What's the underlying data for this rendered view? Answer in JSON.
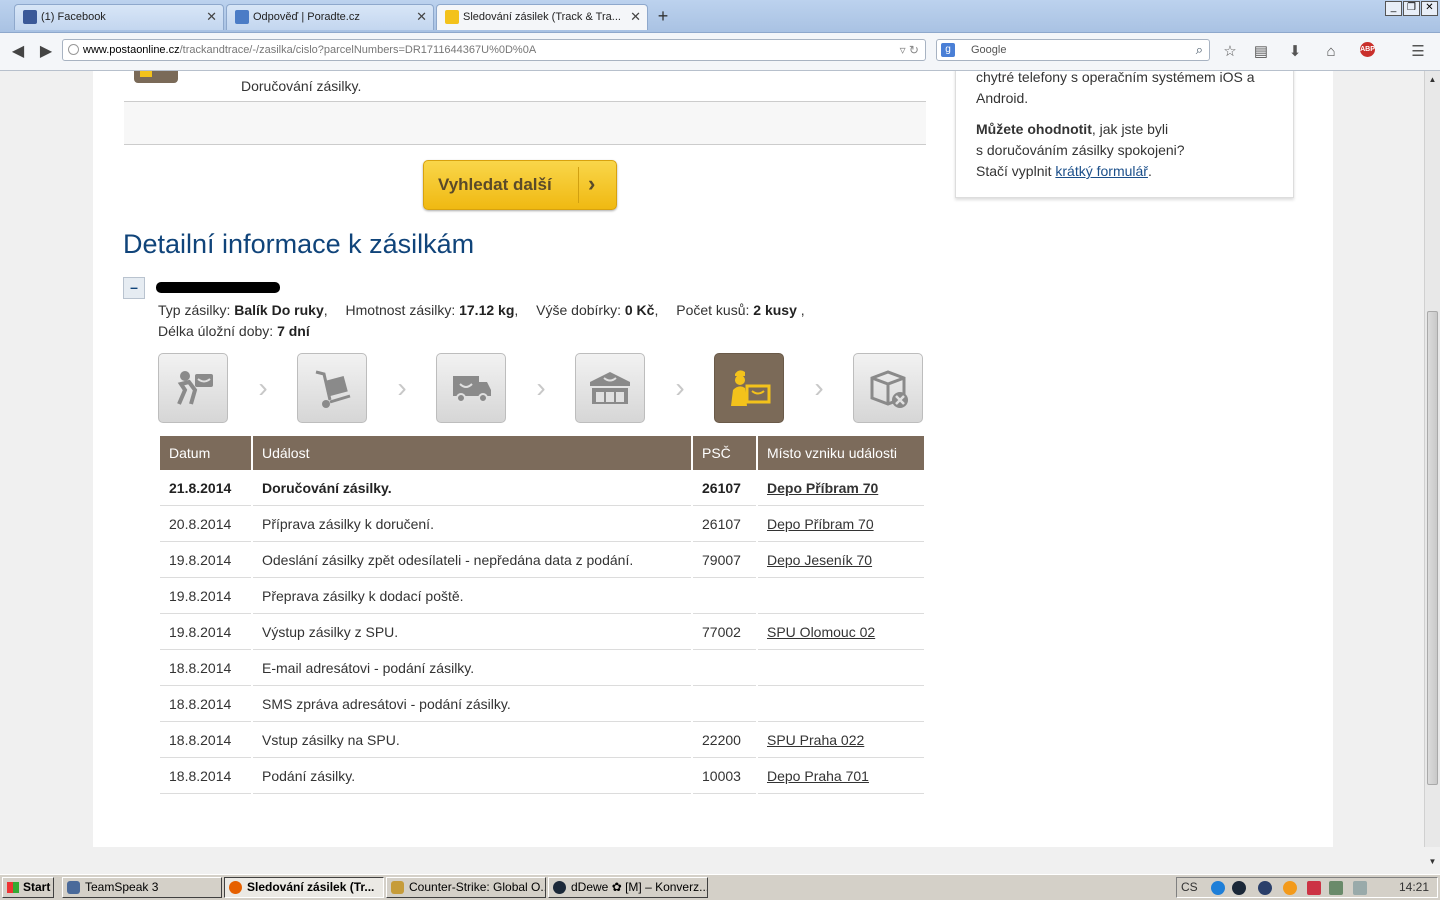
{
  "browser": {
    "tabs": [
      {
        "title": "(1) Facebook",
        "color": "#3b5998"
      },
      {
        "title": "Odpověď | Poradte.cz",
        "color": "#4b7cc6"
      },
      {
        "title": "Sledování zásilek (Track & Tra...",
        "color": "#f3c21b"
      }
    ],
    "url_domain": "www.postaonline.cz",
    "url_path": "/trackandtrace/-/zasilka/cislo?parcelNumbers=DR1711644367U%0D%0A",
    "search_placeholder": "Google"
  },
  "prev_item": {
    "event": "Doručování zásilky."
  },
  "sidebar": {
    "text1": "chytré telefony s operačním systémem iOS a Android.",
    "rate_bold": "Můžete ohodnotit",
    "rate_rest1": ", jak jste byli",
    "rate_rest2": "s doručováním zásilky spokojeni?",
    "form_prefix": "Stačí vyplnit ",
    "form_link": "krátký formulář",
    "form_suffix": "."
  },
  "search_next_label": "Vyhledat další",
  "detail_heading": "Detailní informace k zásilkám",
  "parcel": {
    "type_label": "Typ zásilky:",
    "type_value": "Balík Do ruky",
    "weight_label": "Hmotnost zásilky:",
    "weight_value": "17.12  kg",
    "cod_label": "Výše dobírky:",
    "cod_value": "0  Kč",
    "pieces_label": "Počet kusů:",
    "pieces_value": "2  kusy",
    "storage_label": "Délka úložní doby:",
    "storage_value": "7 dní"
  },
  "progress": {
    "active_step": 4,
    "steps": [
      "posted-icon",
      "warehouse-cart-icon",
      "delivery-truck-icon",
      "post-office-icon",
      "courier-delivering-icon",
      "undeliverable-box-icon"
    ]
  },
  "table": {
    "headers": [
      "Datum",
      "Událost",
      "PSČ",
      "Místo vzniku události"
    ],
    "rows": [
      [
        "21.8.2014",
        "Doručování zásilky.",
        "26107",
        "Depo Příbram 70"
      ],
      [
        "20.8.2014",
        "Příprava zásilky k doručení.",
        "26107",
        "Depo Příbram 70"
      ],
      [
        "19.8.2014",
        "Odeslání zásilky zpět odesílateli - nepředána data z podání.",
        "79007",
        "Depo Jeseník 70"
      ],
      [
        "19.8.2014",
        "Přeprava zásilky k dodací poště.",
        "",
        ""
      ],
      [
        "19.8.2014",
        "Výstup zásilky z SPU.",
        "77002",
        "SPU Olomouc 02"
      ],
      [
        "18.8.2014",
        "E-mail adresátovi - podání zásilky.",
        "",
        ""
      ],
      [
        "18.8.2014",
        "SMS zpráva adresátovi - podání zásilky.",
        "",
        ""
      ],
      [
        "18.8.2014",
        "Vstup zásilky na SPU.",
        "22200",
        "SPU Praha 022"
      ],
      [
        "18.8.2014",
        "Podání zásilky.",
        "10003",
        "Depo Praha 701"
      ]
    ]
  },
  "taskbar": {
    "start": "Start",
    "tasks": [
      {
        "label": "TeamSpeak 3",
        "color": "#4a6a9a"
      },
      {
        "label": "Sledování zásilek (Tr...",
        "color": "#e66000"
      },
      {
        "label": "Counter-Strike: Global O...",
        "color": "#c69c3a"
      },
      {
        "label": "dDewe ✿ [M] – Konverz...",
        "color": "#1b2838"
      }
    ],
    "lang": "CS",
    "clock": "14:21"
  }
}
